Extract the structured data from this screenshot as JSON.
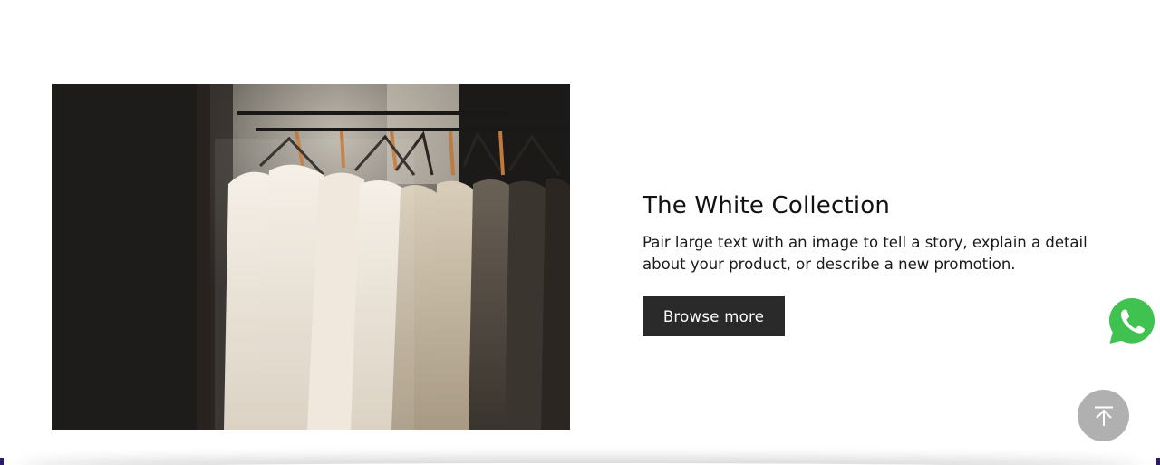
{
  "section": {
    "title": "The White Collection",
    "description": "Pair large text with an image to tell a story, explain a detail about your product, or describe a new promotion.",
    "button_label": "Browse more"
  },
  "image": {
    "subject": "wedding-dresses-on-rack"
  },
  "floating": {
    "whatsapp_icon": "whatsapp-icon",
    "back_to_top_icon": "arrow-up-to-top-icon"
  },
  "colors": {
    "button_bg": "#2a2a2a",
    "button_text": "#ffffff",
    "whatsapp_green": "#3fc24f",
    "back_to_top_bg": "#b0b0b0",
    "title_text": "#121212"
  }
}
